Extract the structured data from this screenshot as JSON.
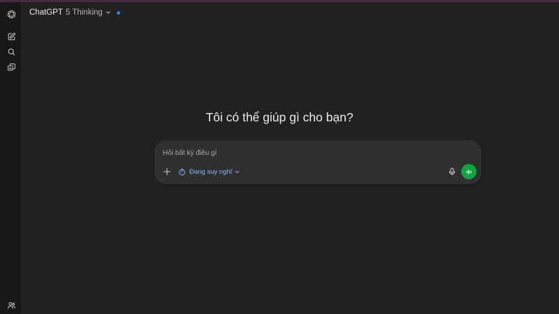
{
  "app": {
    "brand": "ChatGPT",
    "model_label": "5 Thinking",
    "status_dot_color": "#2f80ed"
  },
  "sidebar": {
    "items": [
      {
        "icon": "openai-logo-icon"
      },
      {
        "icon": "new-chat-icon"
      },
      {
        "icon": "search-icon"
      },
      {
        "icon": "library-icon"
      },
      {
        "icon": "profile-icon"
      }
    ]
  },
  "main": {
    "greeting": "Tôi có thể giúp gì cho bạn?"
  },
  "composer": {
    "placeholder": "Hỏi bất kỳ điều gì",
    "value": "",
    "mode_label": "Đang suy nghĩ",
    "mode_color": "#8ab4f8",
    "voice_button_color": "#10a33f"
  }
}
